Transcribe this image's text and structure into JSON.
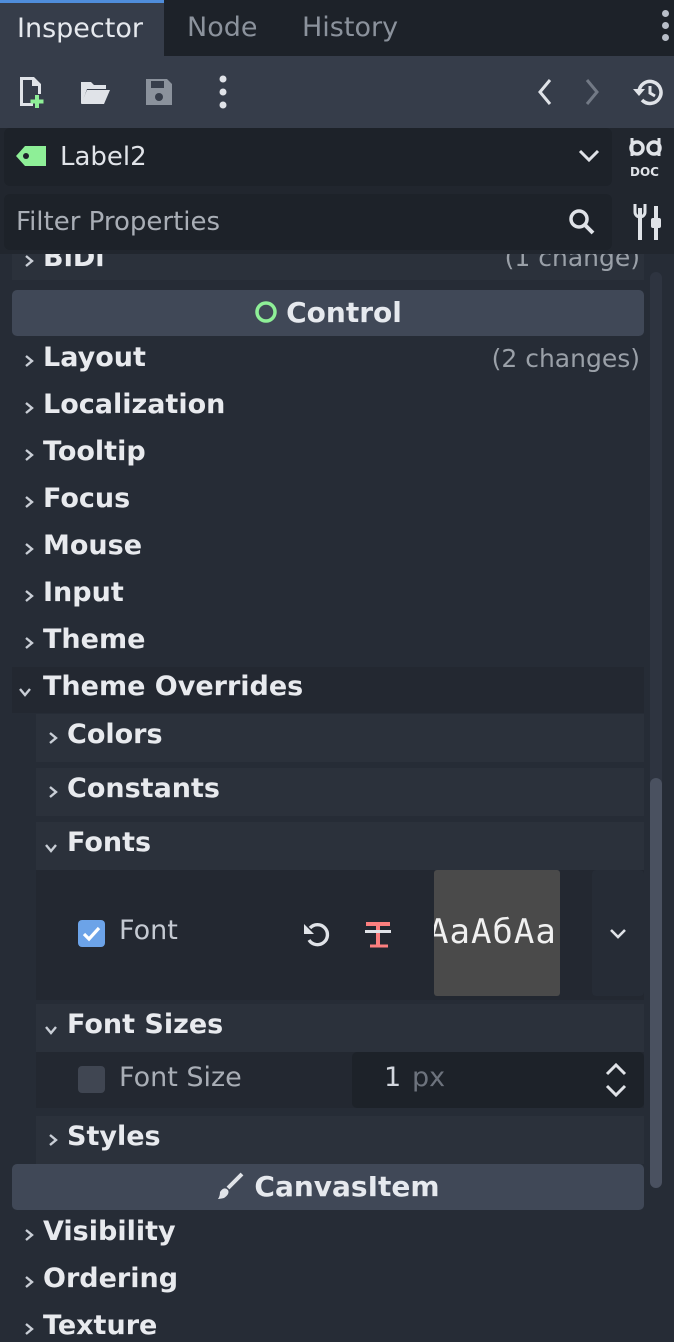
{
  "tabs": [
    {
      "label": "Inspector",
      "active": true
    },
    {
      "label": "Node",
      "active": false
    },
    {
      "label": "History",
      "active": false
    }
  ],
  "node": {
    "name": "Label2"
  },
  "filter": {
    "placeholder": "Filter Properties"
  },
  "sections": {
    "bidi": {
      "label": "BiDi",
      "changes": "(1 change)"
    },
    "control": {
      "label": "Control"
    },
    "layout": {
      "label": "Layout",
      "changes": "(2 changes)"
    },
    "localization": {
      "label": "Localization"
    },
    "tooltip": {
      "label": "Tooltip"
    },
    "focus": {
      "label": "Focus"
    },
    "mouse": {
      "label": "Mouse"
    },
    "input": {
      "label": "Input"
    },
    "theme": {
      "label": "Theme"
    },
    "theme_overrides": {
      "label": "Theme Overrides"
    },
    "colors": {
      "label": "Colors"
    },
    "constants": {
      "label": "Constants"
    },
    "fonts": {
      "label": "Fonts"
    },
    "font": {
      "label": "Font",
      "checked": true,
      "preview": "AaAбAa"
    },
    "font_sizes": {
      "label": "Font Sizes"
    },
    "font_size": {
      "label": "Font Size",
      "checked": false,
      "value": "1",
      "unit": "px"
    },
    "styles": {
      "label": "Styles"
    },
    "canvas_item": {
      "label": "CanvasItem"
    },
    "visibility": {
      "label": "Visibility"
    },
    "ordering": {
      "label": "Ordering"
    },
    "texture": {
      "label": "Texture"
    }
  },
  "colors": {
    "accent": "#4f8ddb",
    "node_icon": "#8eef97",
    "control_icon": "#8eef97",
    "checkbox_on": "#6ca3e8",
    "revert_icon_red": "#fc7f7f"
  }
}
